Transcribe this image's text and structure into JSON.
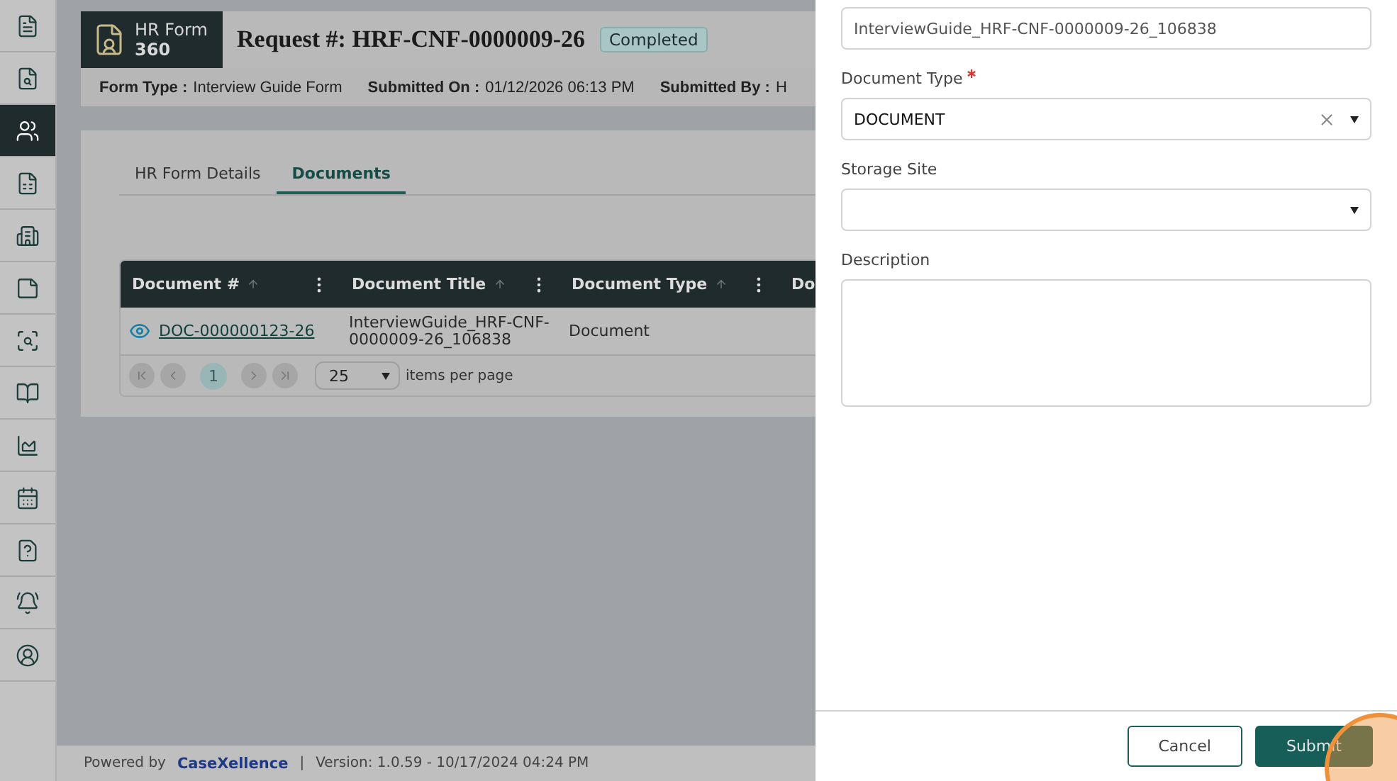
{
  "sidebar": {
    "items": [
      {
        "selected": false
      },
      {
        "selected": false
      },
      {
        "selected": true
      },
      {
        "selected": false
      },
      {
        "selected": false
      },
      {
        "selected": false
      },
      {
        "selected": false
      },
      {
        "selected": false
      },
      {
        "selected": false
      },
      {
        "selected": false
      },
      {
        "selected": false
      },
      {
        "selected": false
      },
      {
        "selected": false
      }
    ]
  },
  "header": {
    "logo": {
      "line_1": "HR Form",
      "line_2": "360"
    },
    "title": "Request #: HRF-CNF-0000009-26",
    "status": "Completed",
    "meta": [
      {
        "label": "Form Type :",
        "value": "Interview Guide Form"
      },
      {
        "label": "Submitted On :",
        "value": "01/12/2026 06:13 PM"
      },
      {
        "label": "Submitted By :",
        "value": "H"
      }
    ]
  },
  "tabs": [
    {
      "label": "HR Form Details",
      "selected": false
    },
    {
      "label": "Documents",
      "selected": true
    }
  ],
  "table": {
    "columns": [
      {
        "label": "Document #",
        "sortable": true
      },
      {
        "label": "Document Title",
        "sortable": true
      },
      {
        "label": "Document Type",
        "sortable": true
      },
      {
        "label": "Do",
        "sortable": false
      }
    ],
    "rows": [
      {
        "document_no": "DOC-000000123-26",
        "title": "InterviewGuide_HRF-CNF-0000009-26_106838",
        "type": "Document"
      }
    ],
    "pager": {
      "pages": [
        {
          "label": "1",
          "selected": true
        }
      ],
      "page_size": "25",
      "items_per_page": "items per page"
    }
  },
  "drawer": {
    "fields": [
      {
        "kind": "text",
        "value": "InterviewGuide_HRF-CNF-0000009-26_106838"
      },
      {
        "kind": "select",
        "label": "Document Type",
        "required": true,
        "value": "DOCUMENT",
        "clearable": true
      },
      {
        "kind": "select",
        "label": "Storage Site",
        "required": false,
        "clearable": false
      },
      {
        "kind": "textarea",
        "label": "Description",
        "required": false
      }
    ],
    "buttons": [
      {
        "label": "Cancel",
        "kind": "secondary"
      },
      {
        "label": "Submit",
        "kind": "primary"
      }
    ]
  },
  "footer": {
    "powered_by": "Powered by",
    "brand": "CaseXellence",
    "separator": "|",
    "version": "Version: 1.0.59 - 10/17/2024 04:24 PM"
  }
}
